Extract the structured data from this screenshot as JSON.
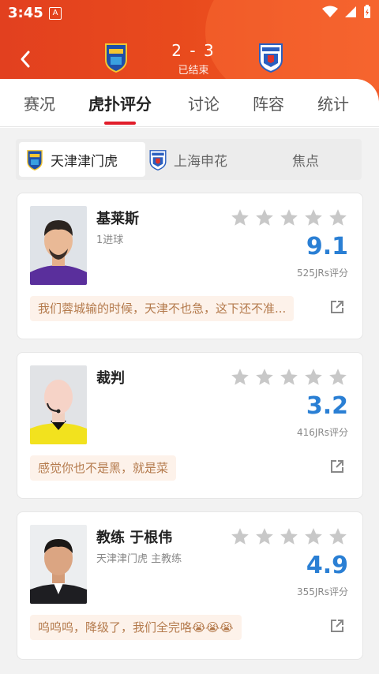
{
  "status_bar": {
    "time": "3:45",
    "notification_icon": "A"
  },
  "match": {
    "score": "2 - 3",
    "state": "已结束"
  },
  "tabs": [
    {
      "label": "赛况"
    },
    {
      "label": "虎扑评分"
    },
    {
      "label": "讨论"
    },
    {
      "label": "阵容"
    },
    {
      "label": "统计"
    }
  ],
  "segments": [
    {
      "label": "天津津门虎"
    },
    {
      "label": "上海申花"
    },
    {
      "label": "焦点"
    }
  ],
  "players": [
    {
      "name": "基莱斯",
      "desc": "1进球",
      "rating": "9.1",
      "count": "525JRs评分",
      "comment": "我们蓉城输的时候，天津不也急，这下还不准..."
    },
    {
      "name": "裁判",
      "desc": "",
      "rating": "3.2",
      "count": "416JRs评分",
      "comment": "感觉你也不是黑，就是菜"
    },
    {
      "name": "教练 于根伟",
      "desc": "天津津门虎 主教练",
      "rating": "4.9",
      "count": "355JRs评分",
      "comment": "呜呜呜，降级了，我们全完咯😭😭😭"
    }
  ],
  "colors": {
    "accent": "#e11d2a",
    "header": "#e94b1d",
    "rating": "#2a7fd4"
  }
}
